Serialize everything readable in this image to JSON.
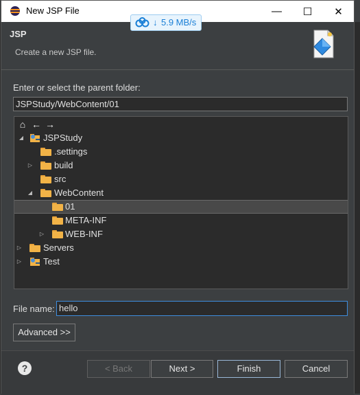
{
  "window": {
    "title": "New JSP File",
    "minimize": "—",
    "maximize": "☐",
    "close": "✕"
  },
  "speed_badge": {
    "arrow": "↓",
    "rate": "5.9 MB/s"
  },
  "header": {
    "title": "JSP",
    "description": "Create a new JSP file."
  },
  "parent_folder": {
    "label": "Enter or select the parent folder:",
    "value": "JSPStudy/WebContent/01"
  },
  "tree": {
    "toolbar": {
      "home": "⌂",
      "back": "←",
      "forward": "→"
    },
    "items": [
      {
        "label": "JSPStudy",
        "expanded": true
      },
      {
        "label": ".settings"
      },
      {
        "label": "build",
        "collapsed": true
      },
      {
        "label": "src"
      },
      {
        "label": "WebContent",
        "expanded": true
      },
      {
        "label": "01",
        "selected": true
      },
      {
        "label": "META-INF"
      },
      {
        "label": "WEB-INF",
        "collapsed": true
      },
      {
        "label": "Servers",
        "collapsed": true
      },
      {
        "label": "Test",
        "collapsed": true
      }
    ]
  },
  "file_name": {
    "label": "File name:",
    "value": "hello"
  },
  "buttons": {
    "advanced": "Advanced >>",
    "back": "< Back",
    "next": "Next >",
    "finish": "Finish",
    "cancel": "Cancel",
    "help": "?"
  },
  "colors": {
    "accent": "#1a7fd6",
    "folder": "#f2b347",
    "selection": "#494949"
  }
}
